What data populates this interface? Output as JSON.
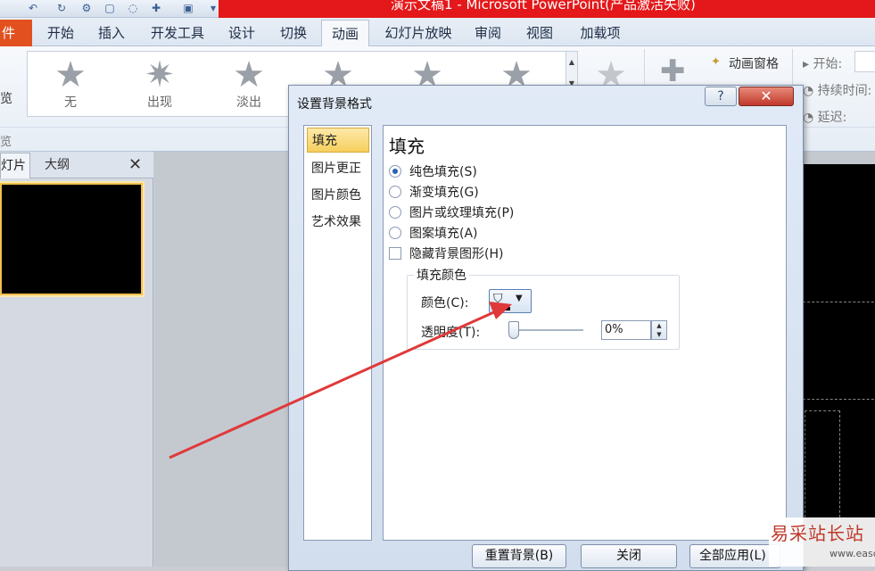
{
  "window": {
    "title": "演示文稿1 - Microsoft PowerPoint(产品激活失败)"
  },
  "ribbon": {
    "file_tab": "件",
    "tabs": [
      "开始",
      "插入",
      "开发工具",
      "设计",
      "切换",
      "动画",
      "幻灯片放映",
      "审阅",
      "视图",
      "加载项"
    ],
    "active_tab": "动画",
    "gallery": [
      "无",
      "出现",
      "淡出"
    ],
    "left_cut_label": "览",
    "left_cut_label2": "览",
    "animation_pane": "动画窗格",
    "start_label": "开始:",
    "duration_label": "持续时间:",
    "delay_label": "延迟:"
  },
  "left_pane": {
    "tab_slides": "灯片",
    "tab_outline": "大纲",
    "close": "✕"
  },
  "dialog": {
    "title": "设置背景格式",
    "help": "?",
    "close": "✕",
    "nav": [
      "填充",
      "图片更正",
      "图片颜色",
      "艺术效果"
    ],
    "selected_nav": "填充",
    "heading": "填充",
    "options": [
      {
        "label": "纯色填充(S)",
        "selected": true
      },
      {
        "label": "渐变填充(G)",
        "selected": false
      },
      {
        "label": "图片或纹理填充(P)",
        "selected": false
      },
      {
        "label": "图案填充(A)",
        "selected": false
      }
    ],
    "hide_background_graphics": "隐藏背景图形(H)",
    "fill_color_group": "填充颜色",
    "color_label": "颜色(C):",
    "transparency_label": "透明度(T):",
    "transparency_value": "0%",
    "buttons": {
      "reset": "重置背景(B)",
      "close": "关闭",
      "apply_all": "全部应用(L)"
    }
  },
  "watermark": {
    "text": "易采站长站",
    "sub": "www.easck.com"
  },
  "colors": {
    "title_red": "#e4181a",
    "file_tab": "#e2501f",
    "nav_selected": "#f6cf5d",
    "arrow": "#e0393a"
  }
}
